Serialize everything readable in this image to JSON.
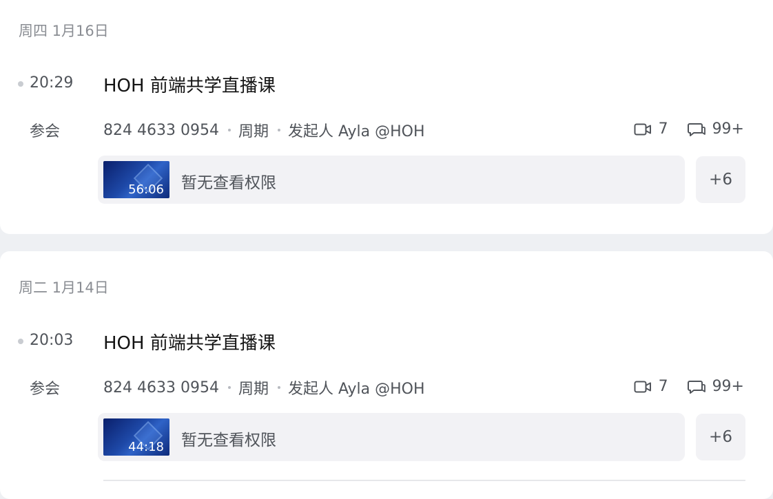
{
  "meetings": [
    {
      "date": "周四 1月16日",
      "time": "20:29",
      "title": "HOH 前端共学直播课",
      "role": "参会",
      "meeting_id": "824 4633 0954",
      "recurrence": "周期",
      "organizer": "发起人 Ayla @HOH",
      "video_count": "7",
      "comment_count": "99+",
      "recording": {
        "duration": "56:06",
        "status": "暂无查看权限"
      },
      "more": "+6"
    },
    {
      "date": "周二 1月14日",
      "time": "20:03",
      "title": "HOH 前端共学直播课",
      "role": "参会",
      "meeting_id": "824 4633 0954",
      "recurrence": "周期",
      "organizer": "发起人 Ayla @HOH",
      "video_count": "7",
      "comment_count": "99+",
      "recording": {
        "duration": "44:18",
        "status": "暂无查看权限"
      },
      "more": "+6"
    }
  ],
  "icons": {
    "video": "video-camera-icon",
    "comment": "comment-bubble-icon"
  },
  "colors": {
    "background": "#eef0f3",
    "card": "#ffffff",
    "text_primary": "#141414",
    "text_secondary": "#50545a",
    "muted": "#8a8d93",
    "chip_bg": "#f2f2f5"
  }
}
